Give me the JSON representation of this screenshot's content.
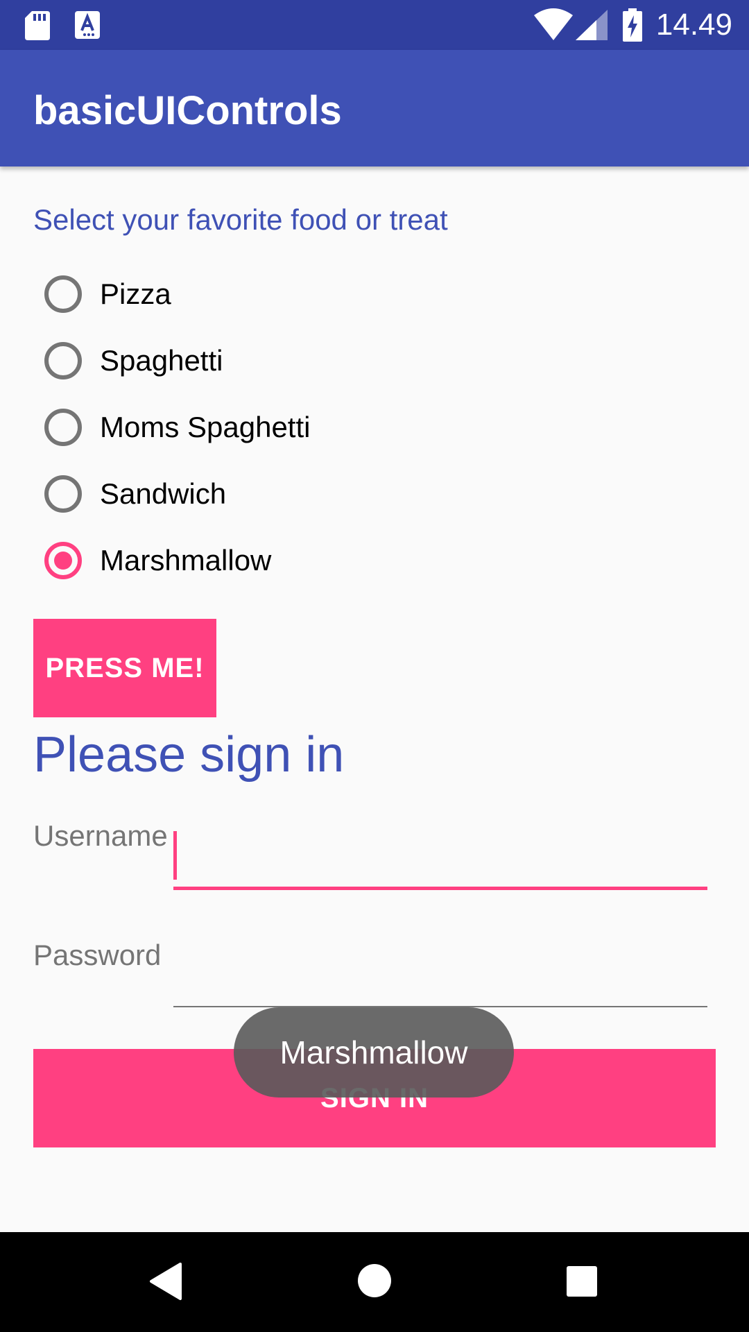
{
  "status_bar": {
    "time": "14.49",
    "icons": [
      "sd-card-icon",
      "accessibility-icon",
      "wifi-icon",
      "signal-icon",
      "battery-charging-icon"
    ]
  },
  "app_bar": {
    "title": "basicUIControls"
  },
  "food_group": {
    "prompt": "Select your favorite food or treat",
    "options": [
      {
        "label": "Pizza",
        "checked": false
      },
      {
        "label": "Spaghetti",
        "checked": false
      },
      {
        "label": "Moms Spaghetti",
        "checked": false
      },
      {
        "label": "Sandwich",
        "checked": false
      },
      {
        "label": "Marshmallow",
        "checked": true
      }
    ],
    "accent_color": "#ff4081"
  },
  "press_button": {
    "label": "PRESS ME!"
  },
  "sign_in": {
    "heading": "Please sign in",
    "username_label": "Username",
    "username_value": "",
    "password_label": "Password",
    "password_value": "",
    "button_label": "SIGN IN"
  },
  "toast": {
    "message": "Marshmallow"
  },
  "nav_bar": {
    "icons": [
      "back-icon",
      "home-icon",
      "recents-icon"
    ]
  },
  "colors": {
    "primary": "#3f51b5",
    "primary_dark": "#303f9f",
    "accent": "#ff4081"
  }
}
